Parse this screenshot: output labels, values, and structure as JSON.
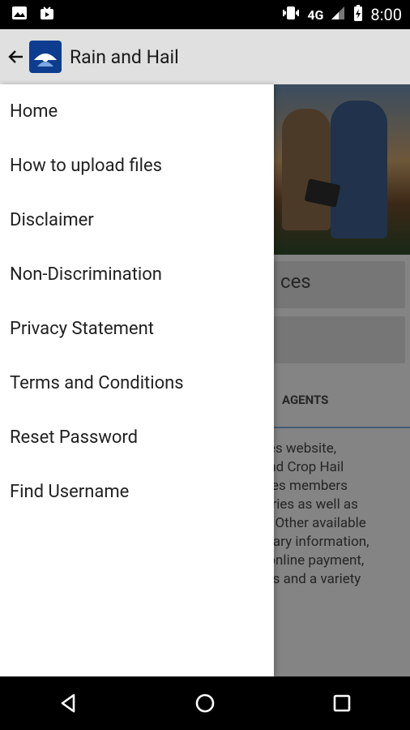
{
  "status_bar": {
    "network_label": "4G",
    "time": "8:00"
  },
  "app_bar": {
    "title": "Rain and Hail",
    "logo_text": "Rain and Hail"
  },
  "drawer": {
    "items": [
      {
        "label": "Home"
      },
      {
        "label": "How to upload files"
      },
      {
        "label": "Disclaimer"
      },
      {
        "label": "Non-Discrimination"
      },
      {
        "label": "Privacy Statement"
      },
      {
        "label": "Terms and Conditions"
      },
      {
        "label": "Reset Password"
      },
      {
        "label": "Find Username"
      }
    ]
  },
  "background": {
    "button_one_text": "ces",
    "tab_agents_label": "AGENTS",
    "body_lines": [
      "ces website,",
      "and Crop Hail",
      "ices members",
      "uiries as well as",
      "s. Other available",
      "mary information,",
      "l online payment,",
      "tes and a variety"
    ]
  },
  "colors": {
    "app_bar_bg": "#e0e0e0",
    "drawer_bg": "#ffffff",
    "accent": "#79a9d6"
  }
}
